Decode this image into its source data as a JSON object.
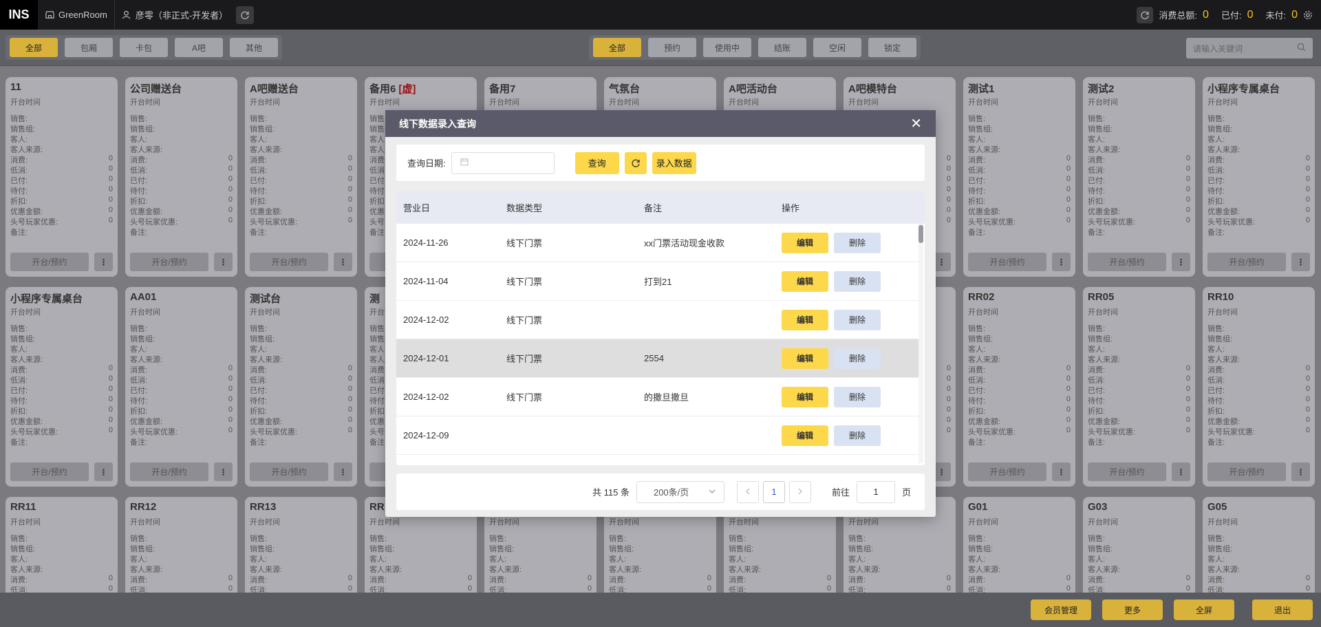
{
  "topbar": {
    "logo": "INS",
    "store": "GreenRoom",
    "user": "彦零（非正式-开发者）",
    "total_label": "消费总额:",
    "total_value": "0",
    "paid_label": "已付:",
    "paid_value": "0",
    "unpaid_label": "未付:",
    "unpaid_value": "0"
  },
  "filters": {
    "area": [
      "全部",
      "包厢",
      "卡包",
      "A吧",
      "其他"
    ],
    "status": [
      "全部",
      "预约",
      "使用中",
      "结账",
      "空闲",
      "锁定"
    ],
    "search_placeholder": "请输入关键词"
  },
  "card_labels": {
    "start_time": "开台时间",
    "fields": [
      "销售:",
      "销售组:",
      "客人:",
      "客人来源:",
      "消费:",
      "低消:",
      "已付:",
      "待付:",
      "折扣:",
      "优惠金额:",
      "头号玩家优惠:",
      "备注:"
    ],
    "zero": "0",
    "open_button": "开台/预约",
    "more": "⋮"
  },
  "cards_row1": [
    "11",
    "公司赠送台",
    "A吧赠送台",
    "备用6",
    "备用7",
    "气氛台",
    "A吧活动台",
    "A吧模特台",
    "测试1",
    "测试2",
    "小程序专属桌台"
  ],
  "virtual_tag": "[虚]",
  "cards_row2": [
    "小程序专属桌台",
    "AA01",
    "测试台",
    "测",
    "",
    "",
    "",
    "",
    "RR02",
    "RR05",
    "RR10"
  ],
  "cards_row3": [
    "RR11",
    "RR12",
    "RR13",
    "RR",
    "",
    "",
    "",
    "",
    "G01",
    "G03",
    "G05"
  ],
  "bottom_buttons": [
    "会员管理",
    "更多",
    "全屏",
    "退出"
  ],
  "modal": {
    "title": "线下数据录入查询",
    "close": "✕",
    "query_date_label": "查询日期:",
    "query_button": "查询",
    "enter_button": "录入数据",
    "columns": [
      "营业日",
      "数据类型",
      "备注",
      "操作"
    ],
    "rows": [
      {
        "date": "2024-11-26",
        "type": "线下门票",
        "note": "xx门票活动现金收款"
      },
      {
        "date": "2024-11-04",
        "type": "线下门票",
        "note": "打到21"
      },
      {
        "date": "2024-12-02",
        "type": "线下门票",
        "note": ""
      },
      {
        "date": "2024-12-01",
        "type": "线下门票",
        "note": "2554"
      },
      {
        "date": "2024-12-02",
        "type": "线下门票",
        "note": "的撒旦撒旦"
      },
      {
        "date": "2024-12-09",
        "type": "",
        "note": ""
      }
    ],
    "edit_label": "编辑",
    "delete_label": "删除",
    "total_text": "共 115 条",
    "page_size": "200条/页",
    "current_page": "1",
    "goto_label": "前往",
    "goto_value": "1",
    "page_suffix": "页"
  }
}
